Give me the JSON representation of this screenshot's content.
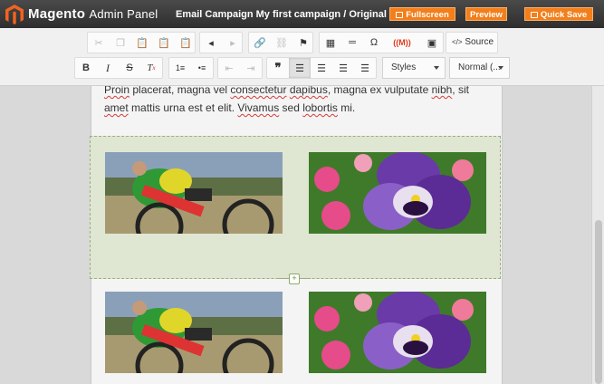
{
  "header": {
    "brand": "Magento",
    "brand_sub": "Admin Panel",
    "campaign_title": "Email Campaign My first campaign / Original",
    "fullscreen_label": "Fullscreen",
    "preview_label": "Preview",
    "quicksave_label": "Quick Save"
  },
  "toolbar": {
    "source_label": "Source",
    "styles_label": "Styles",
    "format_label": "Normal (...",
    "omega_symbol": "Ω",
    "blockquote_symbol": "❞"
  },
  "editor": {
    "text_line1_words": [
      "Proin",
      " placerat, magna vel ",
      "consectetur",
      " ",
      "dapibus",
      ", magna ex vulputate ",
      "nibh",
      ", sit"
    ],
    "text_line2_words": [
      "amet",
      " mattis urna est et elit. ",
      "Vivamus",
      " sed ",
      "lobortis",
      " mi."
    ],
    "add_block_symbol": "+"
  },
  "colors": {
    "accent": "#f27f1b",
    "header_bg": "#353535",
    "selected_block": "#dfe6d2"
  }
}
